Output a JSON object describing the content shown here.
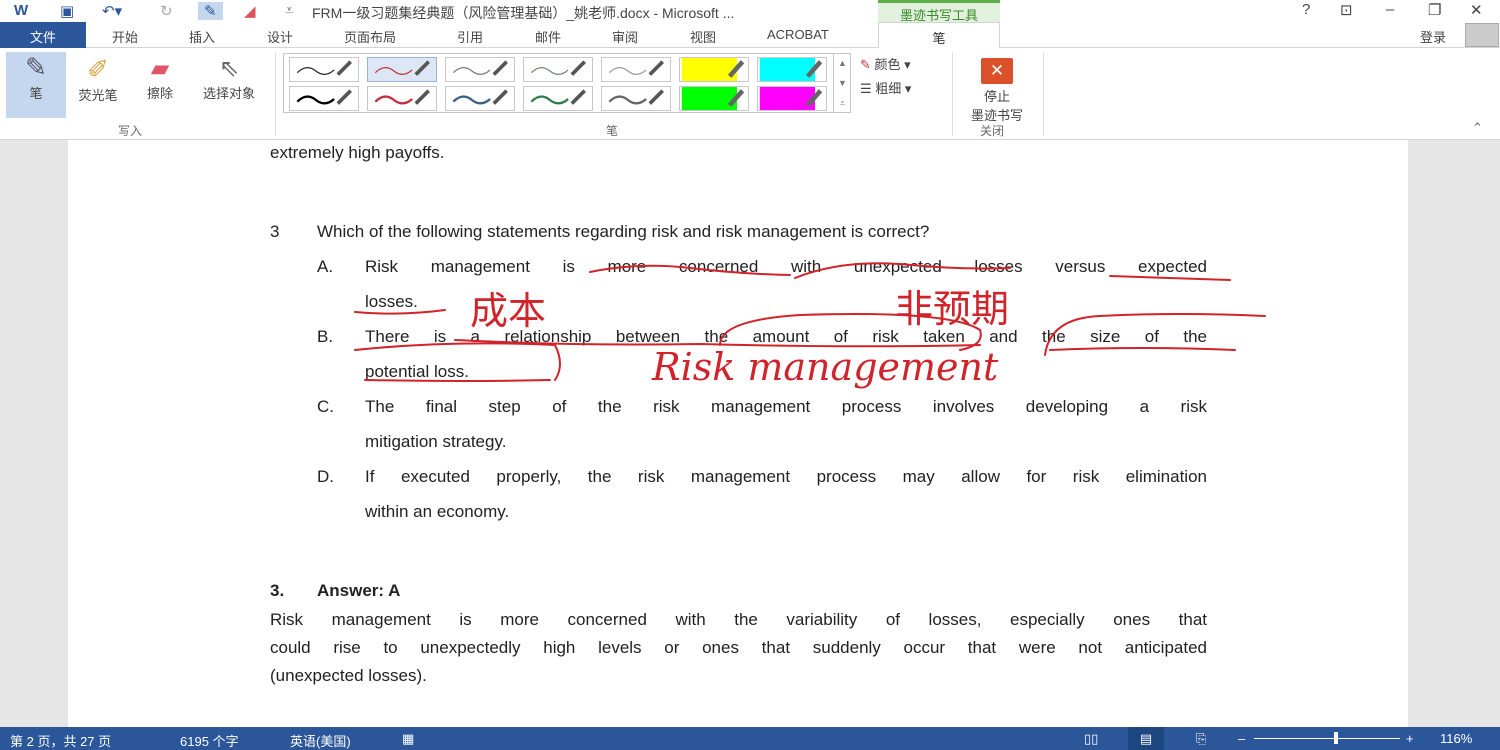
{
  "window": {
    "title": "FRM一级习题集经典题（风险管理基础）_姚老师.docx - Microsoft ...",
    "context_tab": "墨迹书写工具",
    "help": "?",
    "restore_ribbon": "⊡",
    "minimize": "–",
    "maximize": "❐",
    "close": "✕"
  },
  "tabs": [
    "文件",
    "开始",
    "插入",
    "设计",
    "页面布局",
    "引用",
    "邮件",
    "审阅",
    "视图",
    "ACROBAT",
    "笔"
  ],
  "account": {
    "login": "登录"
  },
  "ribbon": {
    "write_group": "写入",
    "pen": "笔",
    "highlighter": "荧光笔",
    "eraser": "擦除",
    "select": "选择对象",
    "pens_group": "笔",
    "color": "颜色",
    "thickness": "粗细",
    "close_group": "关闭",
    "stop_inking_line1": "停止",
    "stop_inking_line2": "墨迹书写",
    "pen_colors": [
      "#222222",
      "#c0303a",
      "#777777",
      "#6a8a6a",
      "#999999",
      "#ffff00",
      "#00ffff",
      "#000000",
      "#c0303a",
      "#3a5f8a",
      "#2e7d4a",
      "#666666",
      "#00ff00",
      "#ff00ff"
    ]
  },
  "document": {
    "prev_line": "extremely high payoffs.",
    "question_number": "3",
    "question": "Which of the following statements regarding risk and risk management is correct?",
    "options": [
      {
        "letter": "A.",
        "lines": [
          "Risk management is more concerned with unexpected losses versus expected",
          "losses."
        ]
      },
      {
        "letter": "B.",
        "lines": [
          "There is a relationship between the amount of risk taken and the size of the",
          "potential loss."
        ]
      },
      {
        "letter": "C.",
        "lines": [
          "The final step of the risk management process involves developing a risk",
          "mitigation strategy."
        ]
      },
      {
        "letter": "D.",
        "lines": [
          "If executed properly, the risk management process may allow for risk elimination",
          "within an economy."
        ]
      }
    ],
    "answer_number": "3.",
    "answer_label": "Answer: A",
    "explanation": [
      "Risk management is more concerned with the variability of losses, especially ones that",
      "could rise to unexpectedly high levels or ones that suddenly occur that were not anticipated",
      "(unexpected losses)."
    ],
    "handwriting": [
      "成本",
      "非预期",
      "Risk management"
    ],
    "ink_color": "#d0232a"
  },
  "status": {
    "page": "第 2 页，共 27 页",
    "words": "6195 个字",
    "language": "英语(美国)",
    "zoom": "116%",
    "zoom_fraction": 0.55
  }
}
